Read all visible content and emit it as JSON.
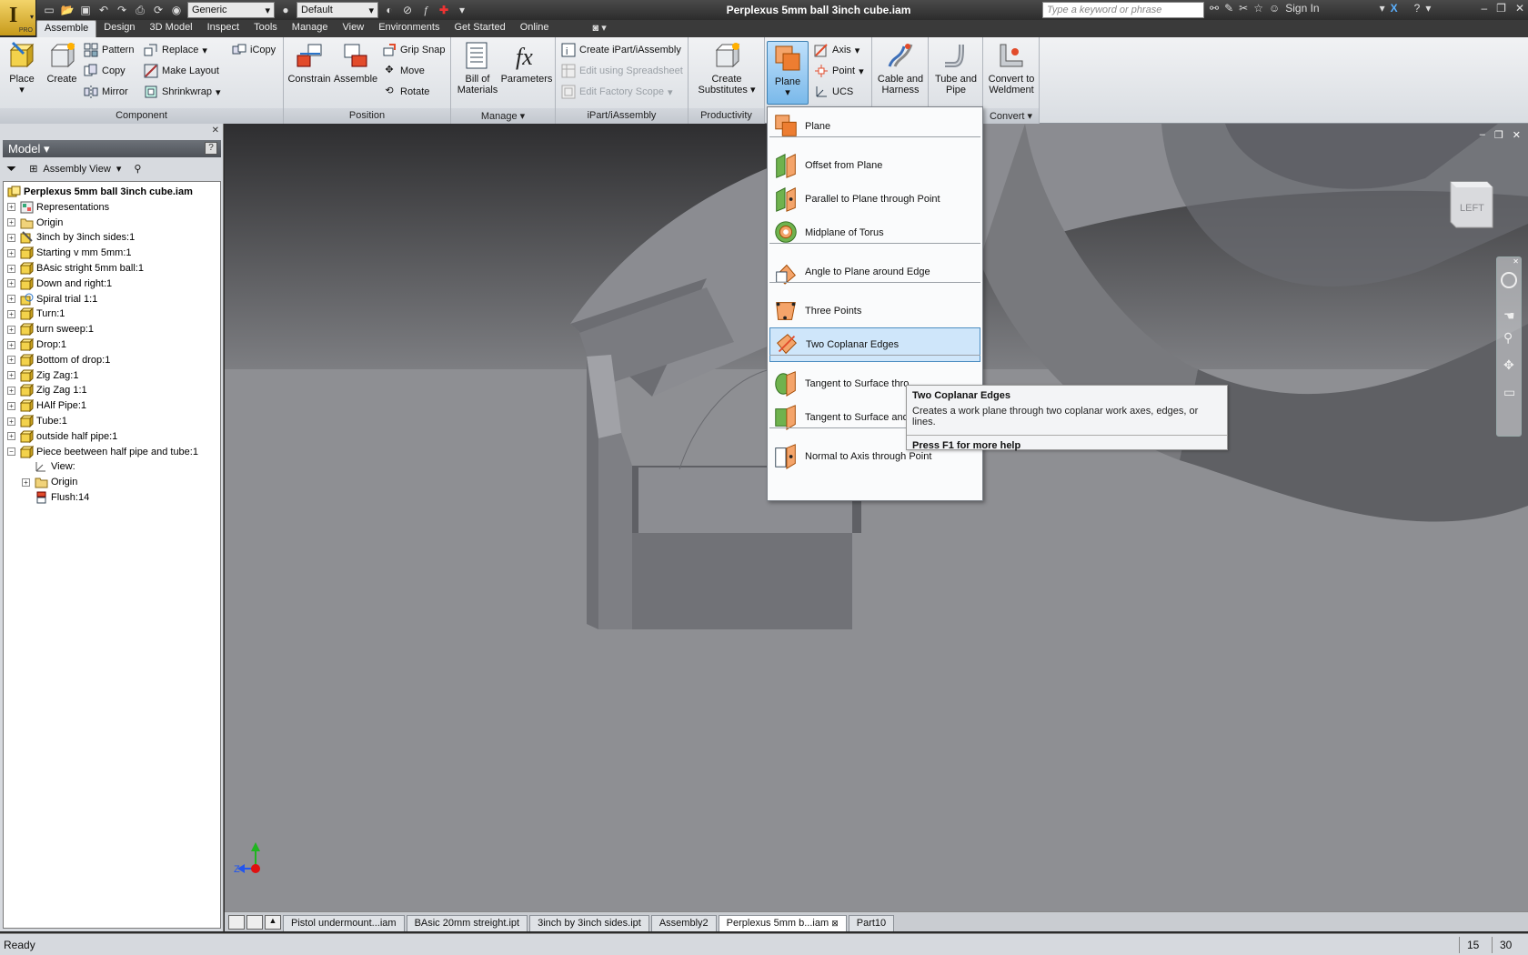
{
  "window": {
    "title": "Perplexus 5mm ball 3inch cube.iam",
    "search_placeholder": "Type a keyword or phrase",
    "sign_in": "Sign In",
    "app_badge": "PRO"
  },
  "quick_access": {
    "material": "Generic",
    "appearance": "Default"
  },
  "ribbon_tabs": [
    "Assemble",
    "Design",
    "3D Model",
    "Inspect",
    "Tools",
    "Manage",
    "View",
    "Environments",
    "Get Started",
    "Online"
  ],
  "ribbon": {
    "component": {
      "label": "Component",
      "place": "Place",
      "create": "Create",
      "pattern": "Pattern",
      "copy": "Copy",
      "mirror": "Mirror",
      "replace": "Replace",
      "make_layout": "Make Layout",
      "shrinkwrap": "Shrinkwrap",
      "icopy": "iCopy"
    },
    "position": {
      "label": "Position",
      "constrain": "Constrain",
      "assemble": "Assemble",
      "grip_snap": "Grip Snap",
      "move": "Move",
      "rotate": "Rotate"
    },
    "manage": {
      "label": "Manage",
      "bom_line1": "Bill of",
      "bom_line2": "Materials",
      "parameters": "Parameters"
    },
    "ipart": {
      "label": "iPart/iAssembly",
      "create": "Create iPart/iAssembly",
      "edit_spreadsheet": "Edit using Spreadsheet",
      "edit_factory": "Edit Factory Scope"
    },
    "productivity": {
      "label": "Productivity",
      "line1": "Create",
      "line2": "Substitutes"
    },
    "work_features": {
      "plane": "Plane",
      "axis": "Axis",
      "point": "Point",
      "ucs": "UCS"
    },
    "cable": {
      "line1": "Cable and",
      "line2": "Harness"
    },
    "tube": {
      "line1": "Tube and",
      "line2": "Pipe"
    },
    "convert": {
      "line1": "Convert to",
      "line2": "Weldment",
      "label": "Convert"
    }
  },
  "browser": {
    "header": "Model",
    "view_selector": "Assembly View",
    "root": "Perplexus 5mm ball 3inch cube.iam",
    "items": [
      "Representations",
      "Origin",
      "3inch by 3inch sides:1",
      "Starting v mm 5mm:1",
      "BAsic stright 5mm ball:1",
      "Down and right:1",
      "Spiral trial 1:1",
      "Turn:1",
      "turn sweep:1",
      "Drop:1",
      "Bottom of drop:1",
      "Zig Zag:1",
      "Zig Zag 1:1",
      "HAlf Pipe:1",
      "Tube:1",
      "outside half pipe:1",
      "Piece beetween half pipe and tube:1"
    ],
    "children": [
      "View:",
      "Origin",
      "Flush:14"
    ]
  },
  "plane_menu": {
    "items": [
      "Plane",
      "Offset from Plane",
      "Parallel to Plane through Point",
      "Midplane of Torus",
      "Angle to Plane around Edge",
      "Three Points",
      "Two Coplanar Edges",
      "Tangent to Surface thro",
      "Tangent to Surface and",
      "Normal to Axis through Point"
    ]
  },
  "tooltip": {
    "title": "Two Coplanar Edges",
    "description": "Creates a work plane through two coplanar work axes, edges, or lines.",
    "help": "Press F1 for more help"
  },
  "viewcube_label": "LEFT",
  "axis_label": "Z",
  "doc_tabs": [
    "Pistol undermount...iam",
    "BAsic 20mm streight.ipt",
    "3inch by 3inch sides.ipt",
    "Assembly2",
    "Perplexus 5mm b...iam",
    "Part10"
  ],
  "status": {
    "text": "Ready",
    "count1": "15",
    "count2": "30"
  },
  "colors": {
    "highlight": "#cfe6fa",
    "ribbon_bg": "#e3e6ea",
    "viewport_bg": "#8e8f93"
  }
}
